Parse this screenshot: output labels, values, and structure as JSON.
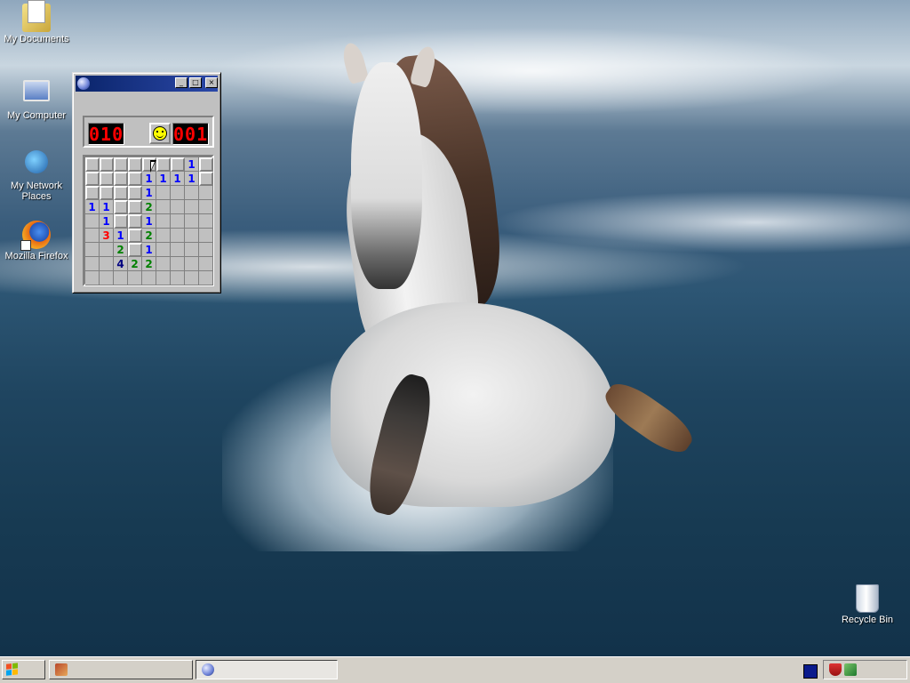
{
  "desktop": {
    "icons": [
      {
        "label": "My Documents",
        "icon": "my-documents-icon"
      },
      {
        "label": "My Computer",
        "icon": "my-computer-icon"
      },
      {
        "label": "My Network Places",
        "icon": "network-places-icon"
      },
      {
        "label": "Mozilla Firefox",
        "icon": "firefox-icon"
      },
      {
        "label": "Recycle Bin",
        "icon": "recycle-bin-icon"
      }
    ]
  },
  "minesweeper": {
    "title": "",
    "mine_counter": "010",
    "timer": "001",
    "face": "smiley-face-icon",
    "board": [
      [
        "h",
        "h",
        "h",
        "h",
        "h",
        "h",
        "h",
        "1",
        "h"
      ],
      [
        "h",
        "h",
        "h",
        "h",
        "1",
        "1",
        "1",
        "1",
        "h"
      ],
      [
        "h",
        "h",
        "h",
        "h",
        "1",
        "",
        "",
        "",
        ""
      ],
      [
        "1",
        "1",
        "h",
        "h",
        "2",
        "",
        "",
        "",
        ""
      ],
      [
        "",
        "1",
        "h",
        "h",
        "1",
        "",
        "",
        "",
        ""
      ],
      [
        "",
        "3",
        "1",
        "h",
        "2",
        "",
        "",
        "",
        ""
      ],
      [
        "",
        "",
        "2",
        "h",
        "1",
        "",
        "",
        "",
        ""
      ],
      [
        "",
        "",
        "4",
        "2",
        "2",
        "",
        "",
        "",
        ""
      ],
      [
        "",
        "",
        "",
        "",
        "",
        "",
        "",
        "",
        ""
      ]
    ]
  },
  "taskbar": {
    "start_icon": "windows-flag-icon",
    "tasks": [
      {
        "label": "",
        "icon": "firefox-task-icon",
        "active": false
      },
      {
        "label": "",
        "icon": "minesweeper-task-icon",
        "active": true
      }
    ],
    "tray_icons": [
      "security-shield-icon",
      "network-icon"
    ]
  },
  "colors": {
    "title_bar": "#0a246a",
    "window_face": "#c0c0c0",
    "led_red": "#ff0000",
    "taskbar": "#d4d0c8"
  }
}
